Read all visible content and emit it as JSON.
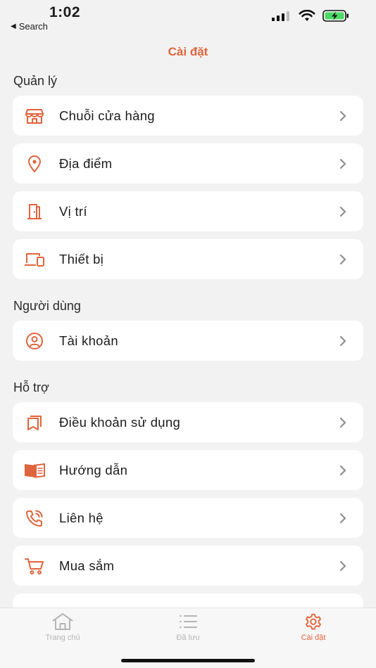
{
  "status_bar": {
    "time": "1:02",
    "back_label": "Search"
  },
  "header": {
    "title": "Cài đặt"
  },
  "colors": {
    "accent": "#e0643c",
    "background": "#f2f2f2",
    "card": "#ffffff",
    "tab_inactive": "#b5b5b5"
  },
  "sections": [
    {
      "title": "Quản lý",
      "items": [
        {
          "label": "Chuỗi cửa hàng",
          "icon": "store-icon"
        },
        {
          "label": "Địa điểm",
          "icon": "location-pin-icon"
        },
        {
          "label": "Vị trí",
          "icon": "door-icon"
        },
        {
          "label": "Thiết bị",
          "icon": "devices-icon"
        }
      ]
    },
    {
      "title": "Người dùng",
      "items": [
        {
          "label": "Tài khoản",
          "icon": "account-circle-icon"
        }
      ]
    },
    {
      "title": "Hỗ trợ",
      "items": [
        {
          "label": "Điều khoản sử dụng",
          "icon": "book-terms-icon"
        },
        {
          "label": "Hướng dẫn",
          "icon": "open-book-icon"
        },
        {
          "label": "Liên hệ",
          "icon": "phone-call-icon"
        },
        {
          "label": "Mua sắm",
          "icon": "shopping-cart-icon"
        }
      ]
    }
  ],
  "tab_bar": {
    "tabs": [
      {
        "label": "Trang chủ",
        "icon": "home-icon",
        "active": false
      },
      {
        "label": "Đã lưu",
        "icon": "list-icon",
        "active": false
      },
      {
        "label": "Cài đặt",
        "icon": "gear-icon",
        "active": true
      }
    ]
  }
}
